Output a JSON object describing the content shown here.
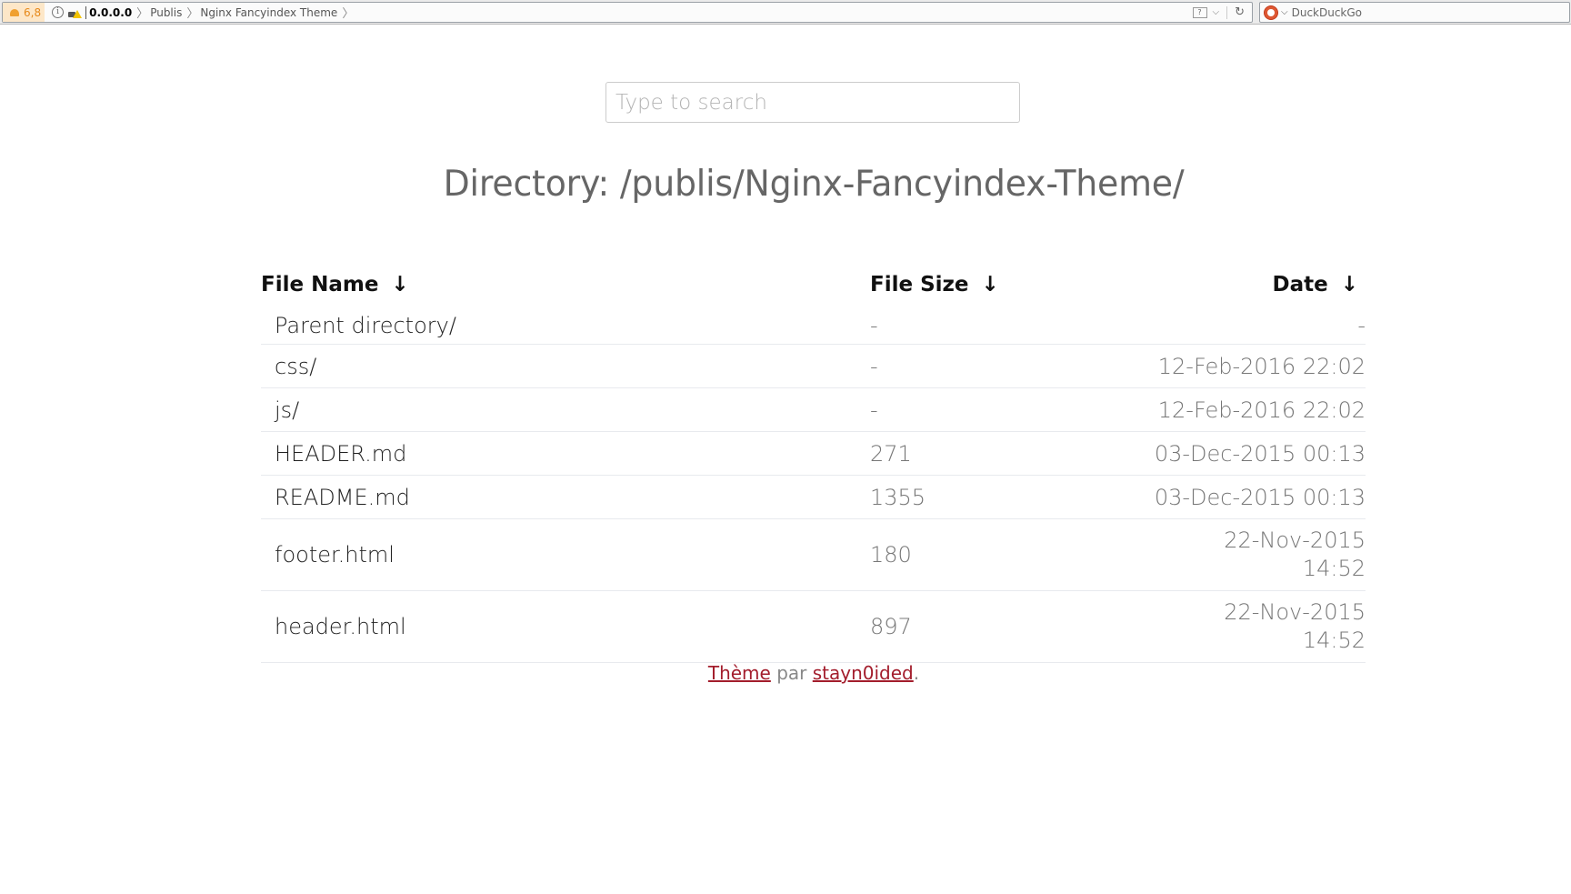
{
  "browser": {
    "shield_count": "6,8",
    "url_host": "0.0.0.0",
    "breadcrumbs": [
      "Publis",
      "Nginx Fancyindex Theme"
    ],
    "search_engine": "DuckDuckGo"
  },
  "search": {
    "placeholder": "Type to search",
    "value": ""
  },
  "page": {
    "title": "Directory: /publis/Nginx-Fancyindex-Theme/"
  },
  "table": {
    "headers": {
      "name": "File Name",
      "size": "File Size",
      "date": "Date",
      "sort_arrow": "↓"
    },
    "rows": [
      {
        "name": "Parent directory/",
        "size": "-",
        "date": "-"
      },
      {
        "name": "css/",
        "size": "-",
        "date": "12-Feb-2016 22:02"
      },
      {
        "name": "js/",
        "size": "-",
        "date": "12-Feb-2016 22:02"
      },
      {
        "name": "HEADER.md",
        "size": "271",
        "date": "03-Dec-2015 00:13"
      },
      {
        "name": "README.md",
        "size": "1355",
        "date": "03-Dec-2015 00:13"
      },
      {
        "name": "footer.html",
        "size": "180",
        "date": "22-Nov-2015 14:52"
      },
      {
        "name": "header.html",
        "size": "897",
        "date": "22-Nov-2015 14:52"
      }
    ]
  },
  "footer": {
    "theme_link": "Thème",
    "by": "par",
    "author_link": "stayn0ided",
    "period": "."
  },
  "colors": {
    "link": "#a31d2c",
    "muted_text": "#777777",
    "title_text": "#666666"
  }
}
